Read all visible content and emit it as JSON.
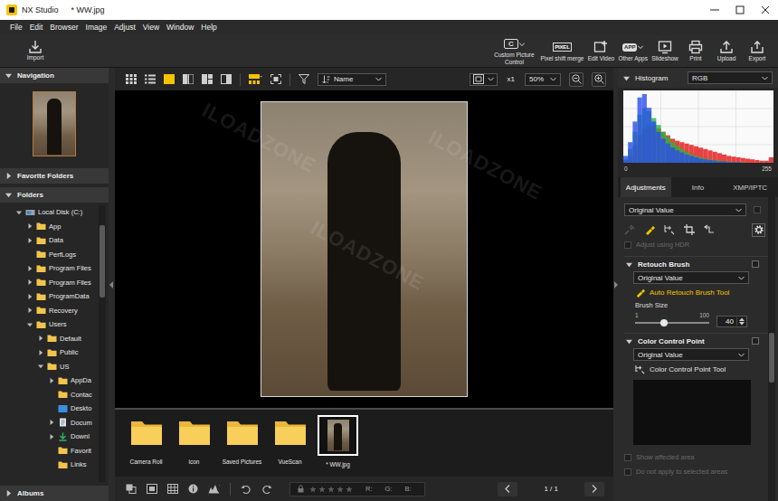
{
  "window": {
    "title": "NX Studio",
    "document": "* WW.jpg"
  },
  "menu": [
    "File",
    "Edit",
    "Browser",
    "Image",
    "Adjust",
    "View",
    "Window",
    "Help"
  ],
  "toolbar": {
    "import": "Import",
    "tools": [
      {
        "kind": "custom-picture",
        "label": "Custom Picture Control",
        "icon_text": "C"
      },
      {
        "kind": "pixel",
        "label": "Pixel shift merge",
        "icon_text": "PIXEL"
      },
      {
        "kind": "edit-video",
        "label": "Edit Video"
      },
      {
        "kind": "other-apps",
        "label": "Other Apps",
        "icon_text": "APP"
      },
      {
        "kind": "slideshow",
        "label": "Slideshow"
      },
      {
        "kind": "print",
        "label": "Print"
      },
      {
        "kind": "upload",
        "label": "Upload"
      },
      {
        "kind": "export",
        "label": "Export"
      }
    ]
  },
  "left_panel": {
    "navigation": {
      "title": "Navigation",
      "expanded": true
    },
    "favorites": {
      "title": "Favorite Folders",
      "expanded": false
    },
    "folders": {
      "title": "Folders",
      "expanded": true
    },
    "albums": {
      "title": "Albums",
      "expanded": false
    }
  },
  "folder_tree": [
    {
      "label": "Local Disk (C:)",
      "depth": 0,
      "kind": "drive",
      "has_children": true,
      "expanded": true
    },
    {
      "label": "App",
      "depth": 1,
      "kind": "folder",
      "has_children": true,
      "expanded": false
    },
    {
      "label": "Data",
      "depth": 1,
      "kind": "folder",
      "has_children": true,
      "expanded": false
    },
    {
      "label": "PerfLogs",
      "depth": 1,
      "kind": "folder",
      "has_children": false,
      "expanded": false
    },
    {
      "label": "Program Files",
      "depth": 1,
      "kind": "folder",
      "has_children": true,
      "expanded": false
    },
    {
      "label": "Program Files",
      "depth": 1,
      "kind": "folder",
      "has_children": true,
      "expanded": false
    },
    {
      "label": "ProgramData",
      "depth": 1,
      "kind": "folder",
      "has_children": true,
      "expanded": false
    },
    {
      "label": "Recovery",
      "depth": 1,
      "kind": "folder",
      "has_children": true,
      "expanded": false
    },
    {
      "label": "Users",
      "depth": 1,
      "kind": "folder",
      "has_children": true,
      "expanded": true
    },
    {
      "label": "Default",
      "depth": 2,
      "kind": "folder",
      "has_children": true,
      "expanded": false
    },
    {
      "label": "Public",
      "depth": 2,
      "kind": "folder",
      "has_children": true,
      "expanded": false
    },
    {
      "label": "US",
      "depth": 2,
      "kind": "folder",
      "has_children": true,
      "expanded": true
    },
    {
      "label": "AppDa",
      "depth": 3,
      "kind": "folder",
      "has_children": true,
      "expanded": false
    },
    {
      "label": "Contac",
      "depth": 3,
      "kind": "folder",
      "has_children": false,
      "expanded": false
    },
    {
      "label": "Deskto",
      "depth": 3,
      "kind": "desktop",
      "has_children": false,
      "expanded": false
    },
    {
      "label": "Docum",
      "depth": 3,
      "kind": "documents",
      "has_children": true,
      "expanded": false
    },
    {
      "label": "Downl",
      "depth": 3,
      "kind": "downloads",
      "has_children": true,
      "expanded": false
    },
    {
      "label": "Favorit",
      "depth": 3,
      "kind": "folder",
      "has_children": false,
      "expanded": false
    },
    {
      "label": "Links",
      "depth": 3,
      "kind": "folder",
      "has_children": false,
      "expanded": false
    }
  ],
  "viewer_toolbar": {
    "view_modes": [
      {
        "kind": "grid",
        "selected": false
      },
      {
        "kind": "list",
        "selected": false
      },
      {
        "kind": "single",
        "selected": true
      },
      {
        "kind": "split",
        "selected": false
      },
      {
        "kind": "quad",
        "selected": false
      },
      {
        "kind": "compare",
        "selected": false
      }
    ],
    "filmstrip_toggle": {
      "on": true
    },
    "sort": "Name",
    "actual_size": "x1",
    "zoom": "50%"
  },
  "filmstrip": [
    {
      "label": "Camera Roll",
      "kind": "folder",
      "selected": false
    },
    {
      "label": "icon",
      "kind": "folder",
      "selected": false
    },
    {
      "label": "Saved Pictures",
      "kind": "folder",
      "selected": false
    },
    {
      "label": "VueScan",
      "kind": "folder",
      "selected": false
    },
    {
      "label": "* WW.jpg",
      "kind": "image",
      "selected": true
    }
  ],
  "status_bar": {
    "stars": 0,
    "rgb": [
      "R:",
      "G:",
      "B:"
    ],
    "page": "1 / 1"
  },
  "histogram": {
    "title": "Histogram",
    "channel": "RGB",
    "axis_min": "0",
    "axis_max": "255",
    "red": [
      3,
      10,
      25,
      40,
      50,
      55,
      55,
      50,
      45,
      40,
      35,
      32,
      30,
      28,
      26,
      24,
      22,
      20,
      18,
      16,
      14,
      12,
      10,
      9,
      8,
      7,
      6,
      5,
      4,
      3,
      3,
      8
    ],
    "green": [
      5,
      20,
      45,
      70,
      80,
      75,
      65,
      55,
      45,
      38,
      30,
      25,
      20,
      16,
      12,
      10,
      8,
      6,
      5,
      4,
      3,
      2,
      2,
      1,
      1,
      1,
      0,
      0,
      0,
      0,
      0,
      0
    ],
    "blue": [
      10,
      30,
      60,
      95,
      100,
      80,
      60,
      45,
      35,
      28,
      22,
      18,
      15,
      12,
      10,
      8,
      6,
      5,
      4,
      3,
      2,
      2,
      1,
      1,
      1,
      0,
      0,
      0,
      0,
      0,
      0,
      0
    ]
  },
  "adjust_tabs": [
    {
      "label": "Adjustments",
      "selected": true
    },
    {
      "label": "Info",
      "selected": false
    },
    {
      "label": "XMP/IPTC",
      "selected": false
    }
  ],
  "preset": "Original Value",
  "adjust_tools": [
    {
      "kind": "lens",
      "selected": false,
      "disabled": true
    },
    {
      "kind": "retouch",
      "selected": true,
      "disabled": false
    },
    {
      "kind": "color-point",
      "selected": false,
      "disabled": false
    },
    {
      "kind": "crop",
      "selected": false,
      "disabled": false
    },
    {
      "kind": "straighten",
      "selected": false,
      "disabled": false
    }
  ],
  "hdr": {
    "label": "Adjust using HDR",
    "checked": false,
    "disabled": true
  },
  "retouch": {
    "title": "Retouch Brush",
    "expanded": true,
    "enabled": false,
    "preset": "Original Value",
    "tool": "Auto Retouch Brush Tool",
    "tool_active": true,
    "size_label": "Brush Size",
    "min": "1",
    "max": "100",
    "value": "40",
    "level": 0.39
  },
  "color_point": {
    "title": "Color Control Point",
    "expanded": true,
    "enabled": false,
    "preset": "Original Value",
    "tool": "Color Control Point Tool",
    "options": [
      {
        "label": "Show affected area",
        "checked": false,
        "disabled": true
      },
      {
        "label": "Do not apply to selected areas",
        "checked": false,
        "disabled": true
      }
    ]
  },
  "watermark": "ILOADZONE"
}
